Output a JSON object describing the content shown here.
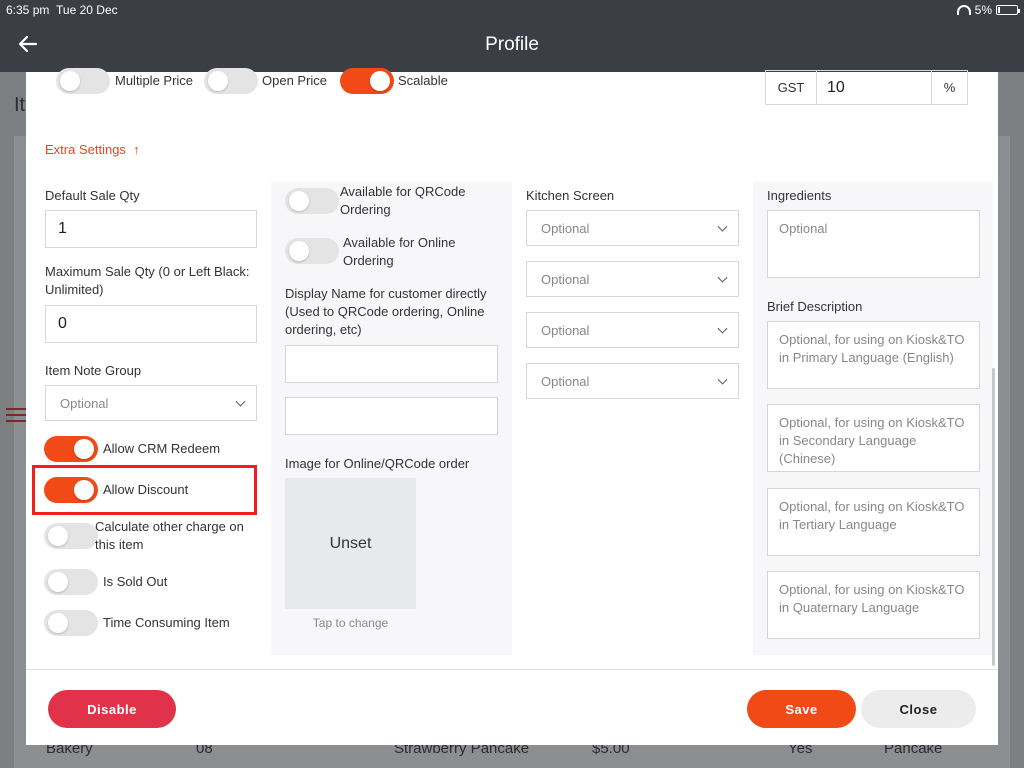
{
  "status_bar": {
    "time": "6:35 pm",
    "date": "Tue 20 Dec",
    "battery": "5%"
  },
  "nav": {
    "title": "Profile"
  },
  "background": {
    "partial_letter": "It",
    "row": [
      "Bakery",
      "08",
      "Strawberry Pancake",
      "$5.00",
      "Yes",
      "Pancake"
    ]
  },
  "top_toggles": [
    {
      "label": "Multiple Price",
      "on": false
    },
    {
      "label": "Open Price",
      "on": false
    },
    {
      "label": "Scalable",
      "on": true
    }
  ],
  "gst": {
    "label": "GST",
    "value": "10",
    "unit": "%"
  },
  "extra_settings": {
    "label": "Extra Settings",
    "icon": "arrow-up-icon"
  },
  "col1": {
    "default_sale_qty": {
      "label": "Default Sale Qty",
      "value": "1"
    },
    "max_sale_qty": {
      "label": "Maximum Sale Qty (0 or Left Black: Unlimited)",
      "value": "0"
    },
    "item_note_group": {
      "label": "Item Note Group",
      "value": "Optional"
    },
    "toggles": [
      {
        "label": "Allow CRM Redeem",
        "on": true
      },
      {
        "label": "Allow Discount",
        "on": true
      },
      {
        "label": "Calculate other charge on this item",
        "on": false
      },
      {
        "label": "Is Sold Out",
        "on": false
      },
      {
        "label": "Time Consuming Item",
        "on": false
      }
    ]
  },
  "col2": {
    "toggles": [
      {
        "label": "Available for QRCode Ordering",
        "on": false
      },
      {
        "label": "Available for Online Ordering",
        "on": false
      }
    ],
    "display_name_label": "Display Name for customer directly (Used to QRCode ordering, Online ordering, etc)",
    "display_name_1": "",
    "display_name_2": "",
    "image_label": "Image for Online/QRCode order",
    "image_placeholder": "Unset",
    "image_hint": "Tap to change"
  },
  "col3": {
    "label": "Kitchen Screen",
    "selects": [
      "Optional",
      "Optional",
      "Optional",
      "Optional"
    ]
  },
  "col4": {
    "ingredients_label": "Ingredients",
    "ingredients_placeholder": "Optional",
    "brief_label": "Brief Description",
    "descriptions": [
      "Optional, for using on Kiosk&TO in Primary Language (English)",
      "Optional, for using on Kiosk&TO in Secondary Language (Chinese)",
      "Optional, for using on Kiosk&TO in Tertiary Language",
      "Optional, for using on Kiosk&TO in Quaternary Language"
    ]
  },
  "footer": {
    "disable": "Disable",
    "save": "Save",
    "close": "Close"
  },
  "colors": {
    "accent": "#f24a16",
    "disable": "#e0334a",
    "nav": "#3b3e45",
    "highlight": "#f21d1d"
  }
}
